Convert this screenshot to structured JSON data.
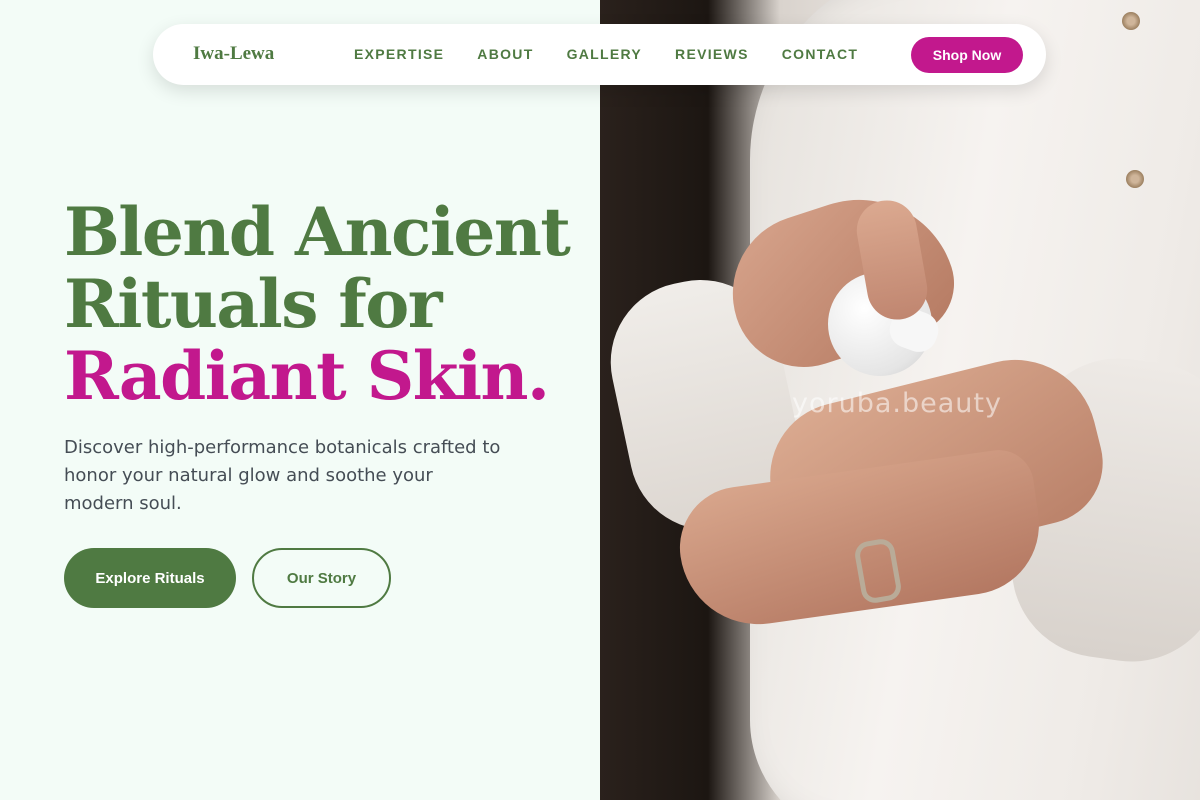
{
  "nav": {
    "brand": "Iwa-Lewa",
    "links": [
      "EXPERTISE",
      "ABOUT",
      "GALLERY",
      "REVIEWS",
      "CONTACT"
    ],
    "cta": "Shop Now"
  },
  "hero": {
    "headline_line1": "Blend Ancient",
    "headline_line2": "Rituals for",
    "headline_accent": "Radiant Skin.",
    "subtext": "Discover high-performance botanicals crafted to honor your natural glow and soothe your modern soul.",
    "primary_cta": "Explore Rituals",
    "secondary_cta": "Our Story"
  },
  "image": {
    "watermark": "yoruba.beauty",
    "subject": "hands-applying-lotion-photo"
  },
  "colors": {
    "brand_green": "#4f7a42",
    "accent_magenta": "#c2188d",
    "background": "#f3fcf7",
    "body_text": "#454d55"
  }
}
